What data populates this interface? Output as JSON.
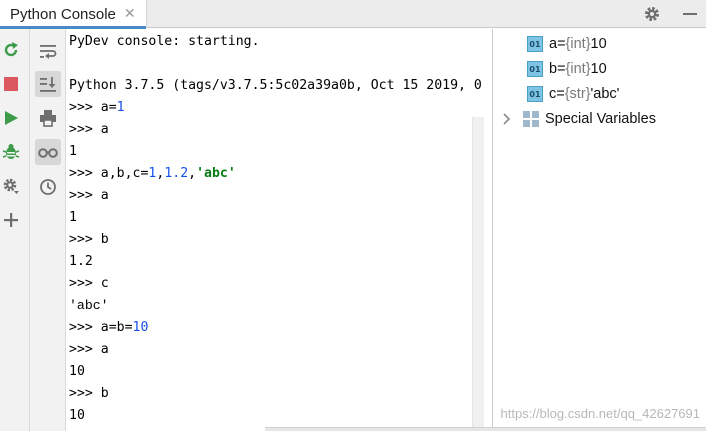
{
  "tab": {
    "title": "Python Console",
    "close": "✕"
  },
  "title_actions": [
    {
      "icon": "gear-icon"
    },
    {
      "icon": "minimize-icon"
    }
  ],
  "toolbar_left": [
    {
      "icon": "rerun-icon",
      "color": "#3d9c4a"
    },
    {
      "icon": "stop-icon",
      "color": "#db5860"
    },
    {
      "icon": "run-icon",
      "color": "#3d9c4a"
    },
    {
      "icon": "debug-bug-icon",
      "color": "#3d9c4a"
    },
    {
      "icon": "settings-gear-icon",
      "color": "#6e6e6e"
    },
    {
      "icon": "add-icon",
      "color": "#6e6e6e"
    }
  ],
  "toolbar_right": [
    {
      "icon": "soft-wrap-icon"
    },
    {
      "icon": "scroll-to-end-icon",
      "active": true
    },
    {
      "icon": "print-icon"
    },
    {
      "icon": "show-variables-icon",
      "active": true
    },
    {
      "icon": "history-icon"
    }
  ],
  "console": {
    "lines": [
      {
        "kind": "text",
        "text": "PyDev console: starting."
      },
      {
        "kind": "text",
        "text": ""
      },
      {
        "kind": "text",
        "text": "Python 3.7.5 (tags/v3.7.5:5c02a39a0b, Oct 15 2019, 0"
      },
      {
        "kind": "input",
        "prompt": ">>> ",
        "parts": [
          {
            "t": "a="
          },
          {
            "t": "1",
            "c": "num"
          }
        ]
      },
      {
        "kind": "input",
        "prompt": ">>> ",
        "parts": [
          {
            "t": "a"
          }
        ]
      },
      {
        "kind": "text",
        "text": "1"
      },
      {
        "kind": "input",
        "prompt": ">>> ",
        "parts": [
          {
            "t": "a,b,c="
          },
          {
            "t": "1",
            "c": "num"
          },
          {
            "t": ","
          },
          {
            "t": "1.2",
            "c": "num"
          },
          {
            "t": ","
          },
          {
            "t": "'abc'",
            "c": "str"
          }
        ]
      },
      {
        "kind": "input",
        "prompt": ">>> ",
        "parts": [
          {
            "t": "a"
          }
        ]
      },
      {
        "kind": "text",
        "text": "1"
      },
      {
        "kind": "input",
        "prompt": ">>> ",
        "parts": [
          {
            "t": "b"
          }
        ]
      },
      {
        "kind": "text",
        "text": "1.2"
      },
      {
        "kind": "input",
        "prompt": ">>> ",
        "parts": [
          {
            "t": "c"
          }
        ]
      },
      {
        "kind": "text",
        "text": "'abc'",
        "c": "out-str"
      },
      {
        "kind": "input",
        "prompt": ">>> ",
        "parts": [
          {
            "t": "a=b="
          },
          {
            "t": "10",
            "c": "num"
          }
        ]
      },
      {
        "kind": "input",
        "prompt": ">>> ",
        "parts": [
          {
            "t": "a"
          }
        ]
      },
      {
        "kind": "text",
        "text": "10"
      },
      {
        "kind": "input",
        "prompt": ">>> ",
        "parts": [
          {
            "t": "b"
          }
        ]
      },
      {
        "kind": "text",
        "text": "10"
      }
    ]
  },
  "variables": {
    "items": [
      {
        "badge": "01",
        "name": "a",
        "eq": " = ",
        "type": "{int}",
        "value": " 10"
      },
      {
        "badge": "01",
        "name": "b",
        "eq": " = ",
        "type": "{int}",
        "value": " 10"
      },
      {
        "badge": "01",
        "name": "c",
        "eq": " = ",
        "type": "{str}",
        "value": " 'abc'"
      }
    ],
    "special": {
      "label": "Special Variables"
    }
  },
  "watermark": "https://blog.csdn.net/qq_42627691",
  "colors": {
    "accent": "#4a88c7",
    "number": "#1750eb",
    "string": "#067d17",
    "badge": "#7dc4e4"
  }
}
